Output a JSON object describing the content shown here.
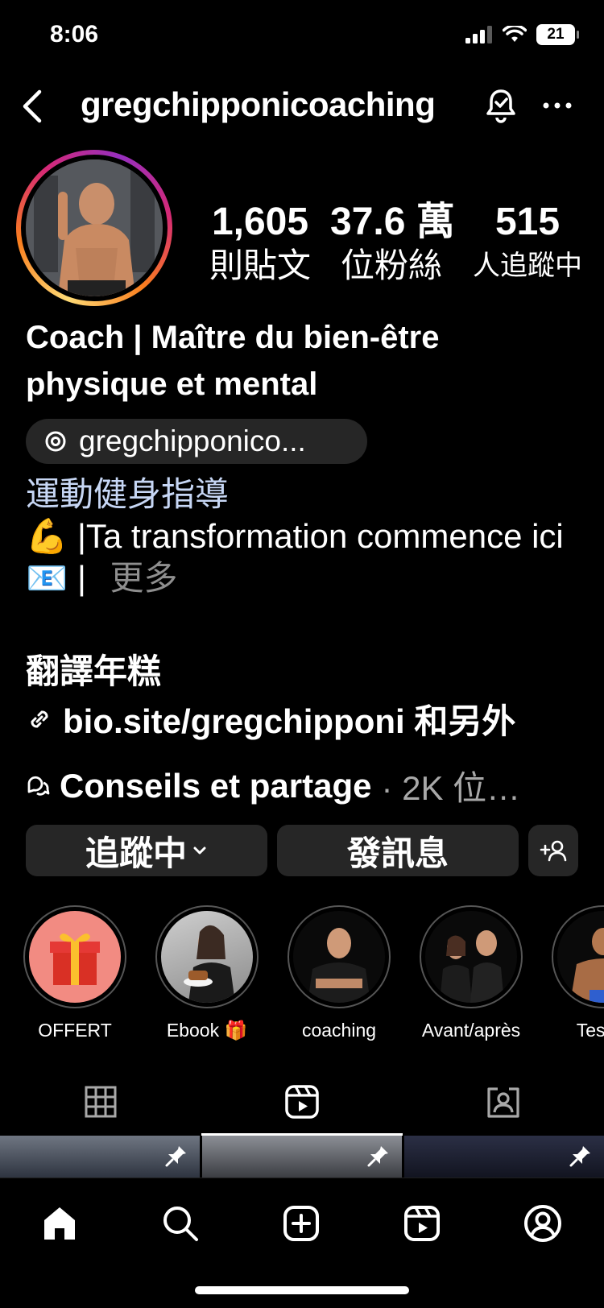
{
  "status_bar": {
    "time": "8:06",
    "battery": "21"
  },
  "header": {
    "username": "gregchipponicoaching"
  },
  "stats": [
    {
      "num": "1,605",
      "label": "則貼文"
    },
    {
      "num": "37.6 萬",
      "label": "位粉絲"
    },
    {
      "num": "515",
      "label": "人追蹤中"
    }
  ],
  "profile": {
    "display_name": "Coach | Maître du bien-être physique et mental",
    "threads_handle": "gregchipponico...",
    "category": "運動健身指導",
    "bio_line1": "💪 |Ta transformation commence ici",
    "bio_line2": "📧 |",
    "more": "更多",
    "translate": "翻譯年糕",
    "link": "bio.site/gregchipponi 和另外",
    "channel_name": "Conseils et partage",
    "channel_meta": "· 2K 位…"
  },
  "actions": {
    "following": "追蹤中",
    "message": "發訊息"
  },
  "highlights": [
    {
      "label": "OFFERT",
      "icon": "gift-icon"
    },
    {
      "label": "Ebook 🎁"
    },
    {
      "label": "coaching"
    },
    {
      "label": "Avant/après"
    },
    {
      "label": "Tes co"
    }
  ],
  "colors": {
    "accent_ring": "#d62976",
    "bio_category": "#c7d7f5",
    "muted": "#8e8e8e",
    "button_bg": "#262626"
  }
}
